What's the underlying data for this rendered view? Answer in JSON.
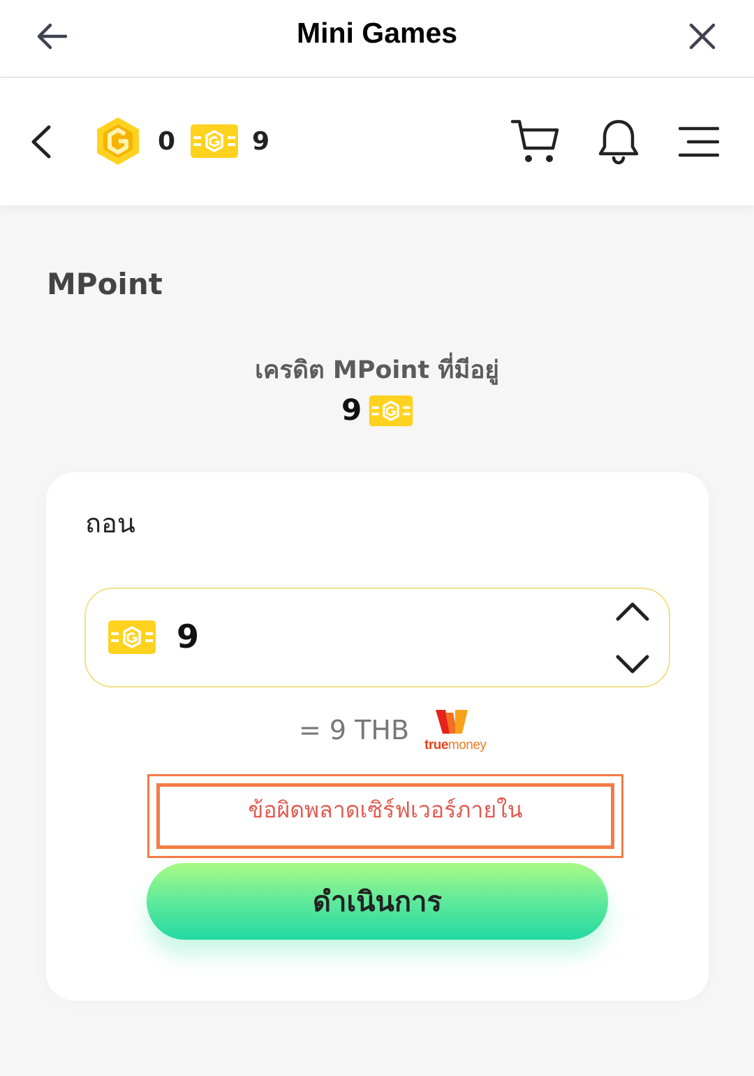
{
  "window": {
    "title": "Mini Games"
  },
  "header": {
    "coin_balance": "0",
    "ticket_balance": "9"
  },
  "page": {
    "section_title": "MPoint"
  },
  "credit": {
    "label": "เครดิต MPoint ที่มีอยู่",
    "value": "9"
  },
  "withdraw": {
    "title": "ถอน",
    "amount": "9",
    "conversion": "= 9 THB",
    "provider": {
      "part1": "true",
      "part2": "money"
    },
    "error_message": "ข้อผิดพลาดเซิร์ฟเวอร์ภายใน",
    "submit_label": "ดำเนินการ"
  },
  "colors": {
    "coin_gold": "#ffd21f",
    "error_border": "#f47b46",
    "error_text": "#e25b51",
    "button_gradient_top": "#a9fa85",
    "button_gradient_bottom": "#23d9a2"
  },
  "icons": {
    "titlebar_back": "arrow-left-icon",
    "titlebar_close": "close-icon",
    "app_back": "chevron-left-icon",
    "coin": "gold-hexagon-coin-icon",
    "ticket": "mpoint-ticket-icon",
    "cart": "cart-icon",
    "notifications": "bell-icon",
    "menu": "hamburger-menu-icon",
    "increment": "chevron-up-icon",
    "decrement": "chevron-down-icon",
    "provider_logo": "truemoney-logo"
  }
}
